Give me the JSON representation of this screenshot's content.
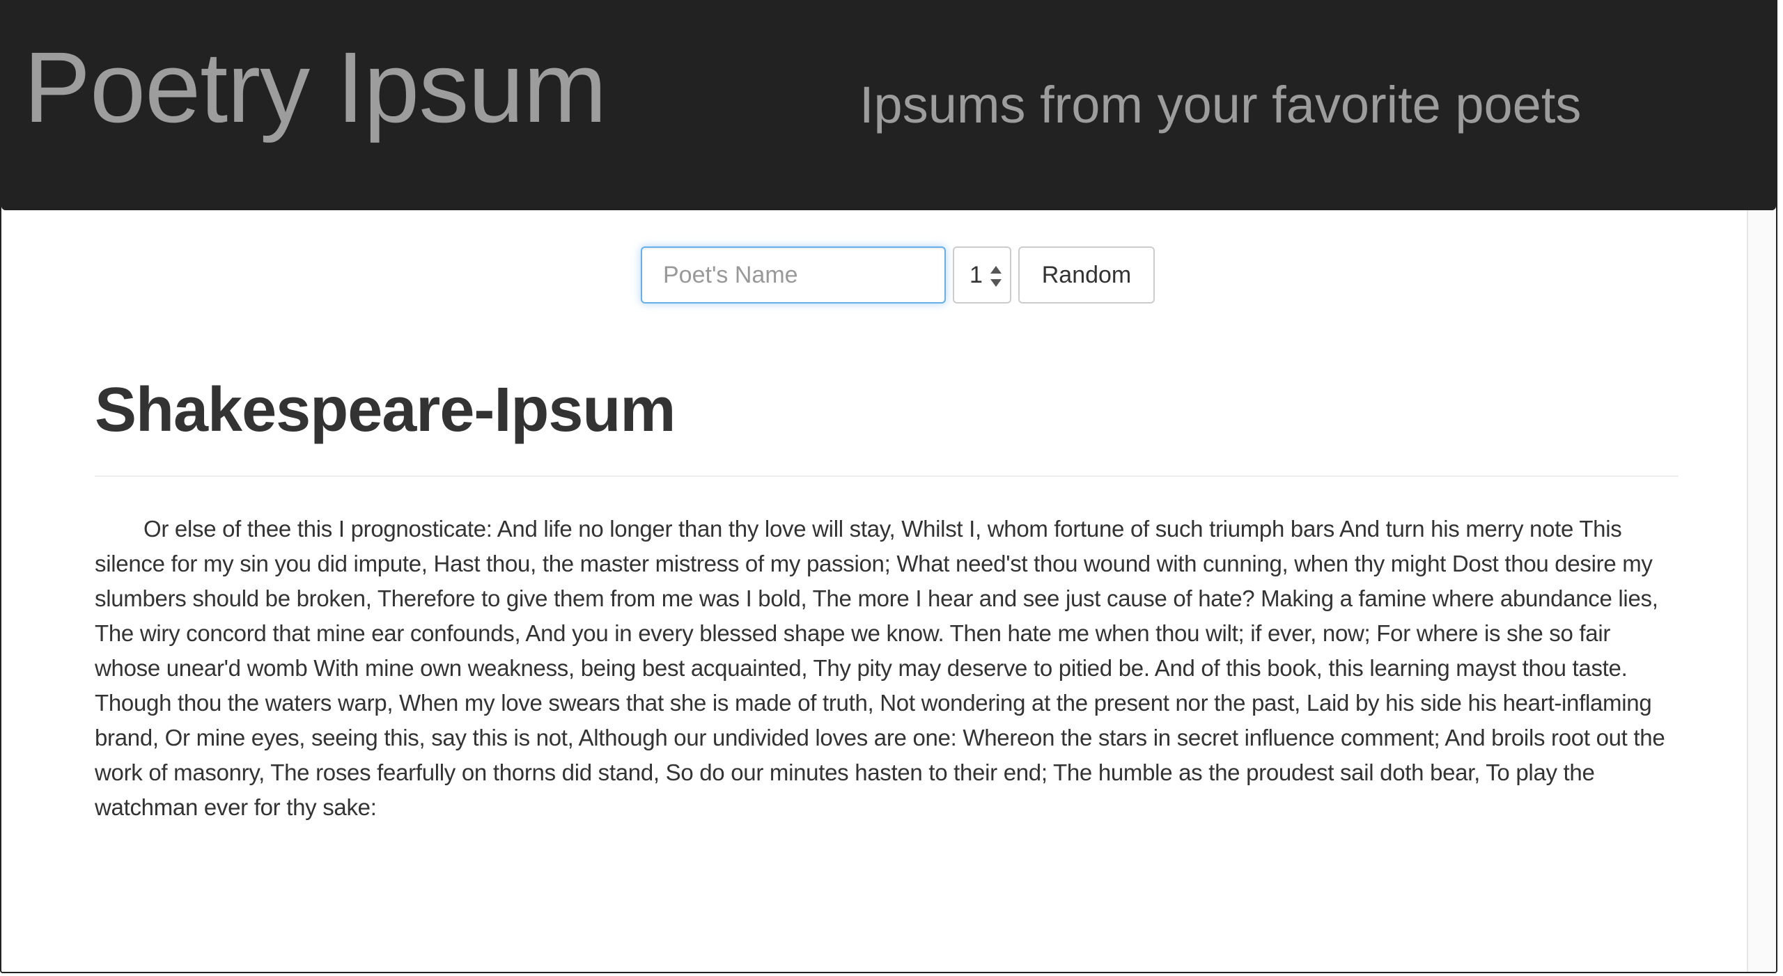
{
  "header": {
    "title": "Poetry Ipsum",
    "tagline": "Ipsums from your favorite poets"
  },
  "controls": {
    "poet_placeholder": "Poet's Name",
    "poet_value": "",
    "count_value": "1",
    "random_label": "Random"
  },
  "main": {
    "title": "Shakespeare-Ipsum",
    "text": "Or else of thee this I prognosticate: And life no longer than thy love will stay, Whilst I, whom fortune of such triumph bars And turn his merry note This silence for my sin you did impute, Hast thou, the master mistress of my passion; What need'st thou wound with cunning, when thy might Dost thou desire my slumbers should be broken, Therefore to give them from me was I bold, The more I hear and see just cause of hate? Making a famine where abundance lies, The wiry concord that mine ear confounds, And you in every blessed shape we know. Then hate me when thou wilt; if ever, now; For where is she so fair whose unear'd womb With mine own weakness, being best acquainted, Thy pity may deserve to pitied be. And of this book, this learning mayst thou taste. Though thou the waters warp, When my love swears that she is made of truth, Not wondering at the present nor the past, Laid by his side his heart-inflaming brand, Or mine eyes, seeing this, say this is not, Although our undivided loves are one: Whereon the stars in secret influence comment; And broils root out the work of masonry, The roses fearfully on thorns did stand, So do our minutes hasten to their end; The humble as the proudest sail doth bear, To play the watchman ever for thy sake:"
  },
  "colors": {
    "header_bg": "#222222",
    "header_text": "#9d9d9d",
    "input_focus_border": "#66afe9",
    "body_text": "#333333"
  }
}
